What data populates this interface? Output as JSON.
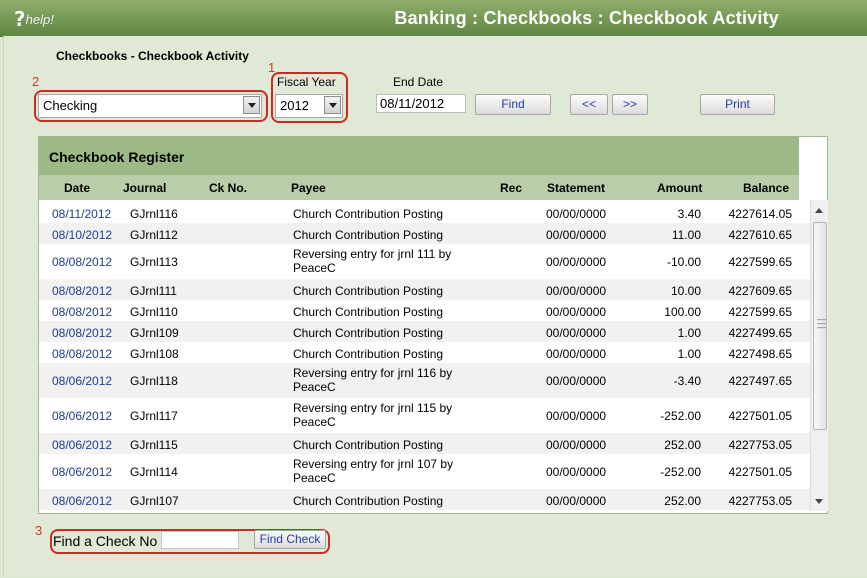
{
  "header": {
    "help_q": "?",
    "help_label": "help!",
    "title": "Banking : Checkbooks : Checkbook Activity"
  },
  "page_heading": "Checkbooks - Checkbook Activity",
  "annotations": {
    "one": "1",
    "two": "2",
    "three": "3"
  },
  "checkbook": {
    "selected": "Checking"
  },
  "fiscal_year": {
    "label": "Fiscal Year",
    "selected": "2012"
  },
  "end_date": {
    "label": "End Date",
    "value": "08/11/2012"
  },
  "buttons": {
    "find": "Find",
    "prev": "<<",
    "next": ">>",
    "print": "Print",
    "find_check": "Find Check"
  },
  "register": {
    "title": "Checkbook Register",
    "columns": [
      "Date",
      "Journal",
      "Ck No.",
      "Payee",
      "Rec",
      "Statement",
      "Amount",
      "Balance"
    ],
    "rows": [
      {
        "date": "08/11/2012",
        "journal": "GJrnl116",
        "ckno": "",
        "payee1": "Church Contribution Posting",
        "payee2": "",
        "rec": "",
        "statement": "00/00/0000",
        "amount": "3.40",
        "balance": "4227614.05"
      },
      {
        "date": "08/10/2012",
        "journal": "GJrnl112",
        "ckno": "",
        "payee1": "Church Contribution Posting",
        "payee2": "",
        "rec": "",
        "statement": "00/00/0000",
        "amount": "11.00",
        "balance": "4227610.65"
      },
      {
        "date": "08/08/2012",
        "journal": "GJrnl113",
        "ckno": "",
        "payee1": "Reversing entry for jrnl 111 by",
        "payee2": "PeaceC",
        "rec": "",
        "statement": "00/00/0000",
        "amount": "-10.00",
        "balance": "4227599.65"
      },
      {
        "date": "08/08/2012",
        "journal": "GJrnl111",
        "ckno": "",
        "payee1": "Church Contribution Posting",
        "payee2": "",
        "rec": "",
        "statement": "00/00/0000",
        "amount": "10.00",
        "balance": "4227609.65"
      },
      {
        "date": "08/08/2012",
        "journal": "GJrnl110",
        "ckno": "",
        "payee1": "Church Contribution Posting",
        "payee2": "",
        "rec": "",
        "statement": "00/00/0000",
        "amount": "100.00",
        "balance": "4227599.65"
      },
      {
        "date": "08/08/2012",
        "journal": "GJrnl109",
        "ckno": "",
        "payee1": "Church Contribution Posting",
        "payee2": "",
        "rec": "",
        "statement": "00/00/0000",
        "amount": "1.00",
        "balance": "4227499.65"
      },
      {
        "date": "08/08/2012",
        "journal": "GJrnl108",
        "ckno": "",
        "payee1": "Church Contribution Posting",
        "payee2": "",
        "rec": "",
        "statement": "00/00/0000",
        "amount": "1.00",
        "balance": "4227498.65"
      },
      {
        "date": "08/06/2012",
        "journal": "GJrnl118",
        "ckno": "",
        "payee1": "Reversing entry for jrnl 116 by",
        "payee2": "PeaceC",
        "rec": "",
        "statement": "00/00/0000",
        "amount": "-3.40",
        "balance": "4227497.65"
      },
      {
        "date": "08/06/2012",
        "journal": "GJrnl117",
        "ckno": "",
        "payee1": "Reversing entry for jrnl 115 by",
        "payee2": "PeaceC",
        "rec": "",
        "statement": "00/00/0000",
        "amount": "-252.00",
        "balance": "4227501.05"
      },
      {
        "date": "08/06/2012",
        "journal": "GJrnl115",
        "ckno": "",
        "payee1": "Church Contribution Posting",
        "payee2": "",
        "rec": "",
        "statement": "00/00/0000",
        "amount": "252.00",
        "balance": "4227753.05"
      },
      {
        "date": "08/06/2012",
        "journal": "GJrnl114",
        "ckno": "",
        "payee1": "Reversing entry for jrnl 107 by",
        "payee2": "PeaceC",
        "rec": "",
        "statement": "00/00/0000",
        "amount": "-252.00",
        "balance": "4227501.05"
      },
      {
        "date": "08/06/2012",
        "journal": "GJrnl107",
        "ckno": "",
        "payee1": "Church Contribution Posting",
        "payee2": "",
        "rec": "",
        "statement": "00/00/0000",
        "amount": "252.00",
        "balance": "4227753.05"
      }
    ]
  },
  "find_check": {
    "label": "Find a Check No",
    "value": ""
  },
  "colors": {
    "header_bar": "#6f9650",
    "panel": "#dfe9d6",
    "register_title": "#9dba86",
    "annotation_red": "#cc2a24",
    "link_blue": "#1f3c8f"
  }
}
